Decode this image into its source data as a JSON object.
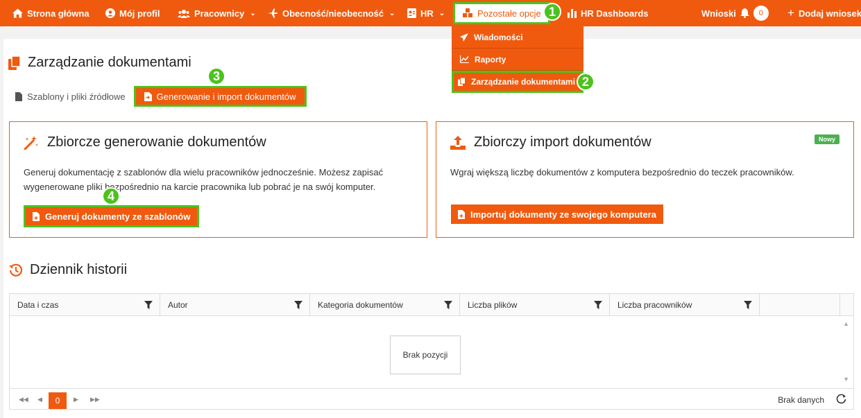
{
  "nav": {
    "home": "Strona główna",
    "profile": "Mój profil",
    "employees": "Pracownicy",
    "attendance": "Obecność/nieobecność",
    "hr": "HR",
    "other": "Pozostałe opcje",
    "dashboards": "HR Dashboards",
    "requests": "Wnioski",
    "requests_count": "0",
    "add_request": "Dodaj wniosek"
  },
  "dropdown": {
    "items": [
      "Wiadomości",
      "Raporty",
      "Zarządzanie dokumentami"
    ]
  },
  "markers": [
    "1",
    "2",
    "3",
    "4"
  ],
  "page": {
    "title": "Zarządzanie dokumentami",
    "tabs": [
      "Szablony i pliki źródłowe",
      "Generowanie i import dokumentów"
    ]
  },
  "generate_panel": {
    "title": "Zbiorcze generowanie dokumentów",
    "desc_line1": "Generuj dokumentację z szablonów dla wielu pracowników jednocześnie. Możesz zapisać",
    "desc_line2": "wygenerowane pliki bezpośrednio na karcie pracownika lub pobrać je na swój komputer.",
    "button": "Generuj dokumenty ze szablonów"
  },
  "import_panel": {
    "title": "Zbiorczy import dokumentów",
    "badge": "Nowy",
    "desc": "Wgraj większą liczbę dokumentów z komputera bezpośrednio do teczek pracowników.",
    "button": "Importuj dokumenty ze swojego komputera"
  },
  "history": {
    "title": "Dziennik historii",
    "columns": [
      "Data i czas",
      "Autor",
      "Kategoria dokumentów",
      "Liczba plików",
      "Liczba pracowników"
    ],
    "empty": "Brak pozycji",
    "page": "0",
    "pager_info": "Brak danych"
  },
  "colors": {
    "accent": "#f05a0f",
    "highlight": "#4cc21d",
    "badge": "#4caf50"
  }
}
